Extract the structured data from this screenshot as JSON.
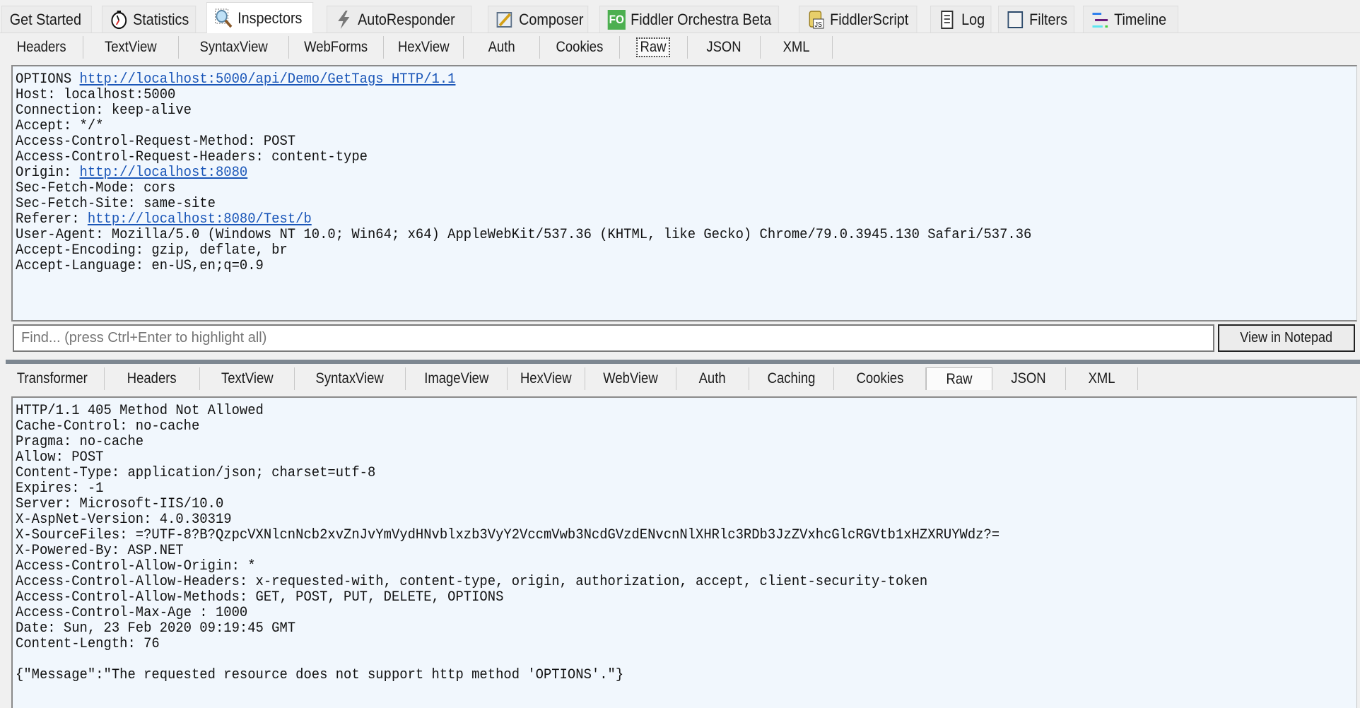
{
  "main_tabs": [
    {
      "label": "Get Started",
      "icon": "none"
    },
    {
      "label": "Statistics",
      "icon": "stopwatch-icon"
    },
    {
      "label": "Inspectors",
      "icon": "magnifier-icon",
      "active": true
    },
    {
      "label": "AutoResponder",
      "icon": "lightning-icon"
    },
    {
      "label": "Composer",
      "icon": "pencil-form-icon"
    },
    {
      "label": "Fiddler Orchestra Beta",
      "icon": "fo-badge-icon",
      "badge_text": "FO",
      "badge_color": "#4caf50"
    },
    {
      "label": "FiddlerScript",
      "icon": "js-scroll-icon",
      "badge_text": "JS"
    },
    {
      "label": "Log",
      "icon": "document-icon"
    },
    {
      "label": "Filters",
      "icon": "checkbox-icon"
    },
    {
      "label": "Timeline",
      "icon": "timeline-icon"
    }
  ],
  "request": {
    "tabs": [
      {
        "label": "Headers"
      },
      {
        "label": "TextView"
      },
      {
        "label": "SyntaxView"
      },
      {
        "label": "WebForms"
      },
      {
        "label": "HexView"
      },
      {
        "label": "Auth"
      },
      {
        "label": "Cookies"
      },
      {
        "label": "Raw",
        "active": true
      },
      {
        "label": "JSON"
      },
      {
        "label": "XML"
      }
    ],
    "lines": [
      {
        "prefix": "OPTIONS ",
        "link": "http://localhost:5000/api/Demo/GetTags HTTP/1.1",
        "suffix": ""
      },
      {
        "prefix": "Host: localhost:5000"
      },
      {
        "prefix": "Connection: keep-alive"
      },
      {
        "prefix": "Accept: */*"
      },
      {
        "prefix": "Access-Control-Request-Method: POST"
      },
      {
        "prefix": "Access-Control-Request-Headers: content-type"
      },
      {
        "prefix": "Origin: ",
        "link": "http://localhost:8080"
      },
      {
        "prefix": "Sec-Fetch-Mode: cors"
      },
      {
        "prefix": "Sec-Fetch-Site: same-site"
      },
      {
        "prefix": "Referer: ",
        "link": "http://localhost:8080/Test/b"
      },
      {
        "prefix": "User-Agent: Mozilla/5.0 (Windows NT 10.0; Win64; x64) AppleWebKit/537.36 (KHTML, like Gecko) Chrome/79.0.3945.130 Safari/537.36"
      },
      {
        "prefix": "Accept-Encoding: gzip, deflate, br"
      },
      {
        "prefix": "Accept-Language: en-US,en;q=0.9"
      }
    ],
    "find_placeholder": "Find... (press Ctrl+Enter to highlight all)",
    "view_in_notepad_label": "View in Notepad"
  },
  "response": {
    "tabs": [
      {
        "label": "Transformer"
      },
      {
        "label": "Headers"
      },
      {
        "label": "TextView"
      },
      {
        "label": "SyntaxView"
      },
      {
        "label": "ImageView"
      },
      {
        "label": "HexView"
      },
      {
        "label": "WebView"
      },
      {
        "label": "Auth"
      },
      {
        "label": "Caching"
      },
      {
        "label": "Cookies"
      },
      {
        "label": "Raw",
        "active": true
      },
      {
        "label": "JSON"
      },
      {
        "label": "XML"
      }
    ],
    "lines": [
      {
        "prefix": "HTTP/1.1 405 Method Not Allowed"
      },
      {
        "prefix": "Cache-Control: no-cache"
      },
      {
        "prefix": "Pragma: no-cache"
      },
      {
        "prefix": "Allow: POST"
      },
      {
        "prefix": "Content-Type: application/json; charset=utf-8"
      },
      {
        "prefix": "Expires: -1"
      },
      {
        "prefix": "Server: Microsoft-IIS/10.0"
      },
      {
        "prefix": "X-AspNet-Version: 4.0.30319"
      },
      {
        "prefix": "X-SourceFiles: =?UTF-8?B?QzpcVXNlcnNcb2xvZnJvYmVydHNvblxzb3VyY2VccmVwb3NcdGVzdENvcnNlXHRlc3RDb3JzZVxhcGlcRGVtb1xHZXRUYWdz?="
      },
      {
        "prefix": "X-Powered-By: ASP.NET"
      },
      {
        "prefix": "Access-Control-Allow-Origin: *"
      },
      {
        "prefix": "Access-Control-Allow-Headers: x-requested-with, content-type, origin, authorization, accept, client-security-token"
      },
      {
        "prefix": "Access-Control-Allow-Methods: GET, POST, PUT, DELETE, OPTIONS"
      },
      {
        "prefix": "Access-Control-Max-Age : 1000"
      },
      {
        "prefix": "Date: Sun, 23 Feb 2020 09:19:45 GMT"
      },
      {
        "prefix": "Content-Length: 76"
      },
      {
        "prefix": ""
      },
      {
        "prefix": "{\"Message\":\"The requested resource does not support http method 'OPTIONS'.\"}"
      }
    ]
  }
}
